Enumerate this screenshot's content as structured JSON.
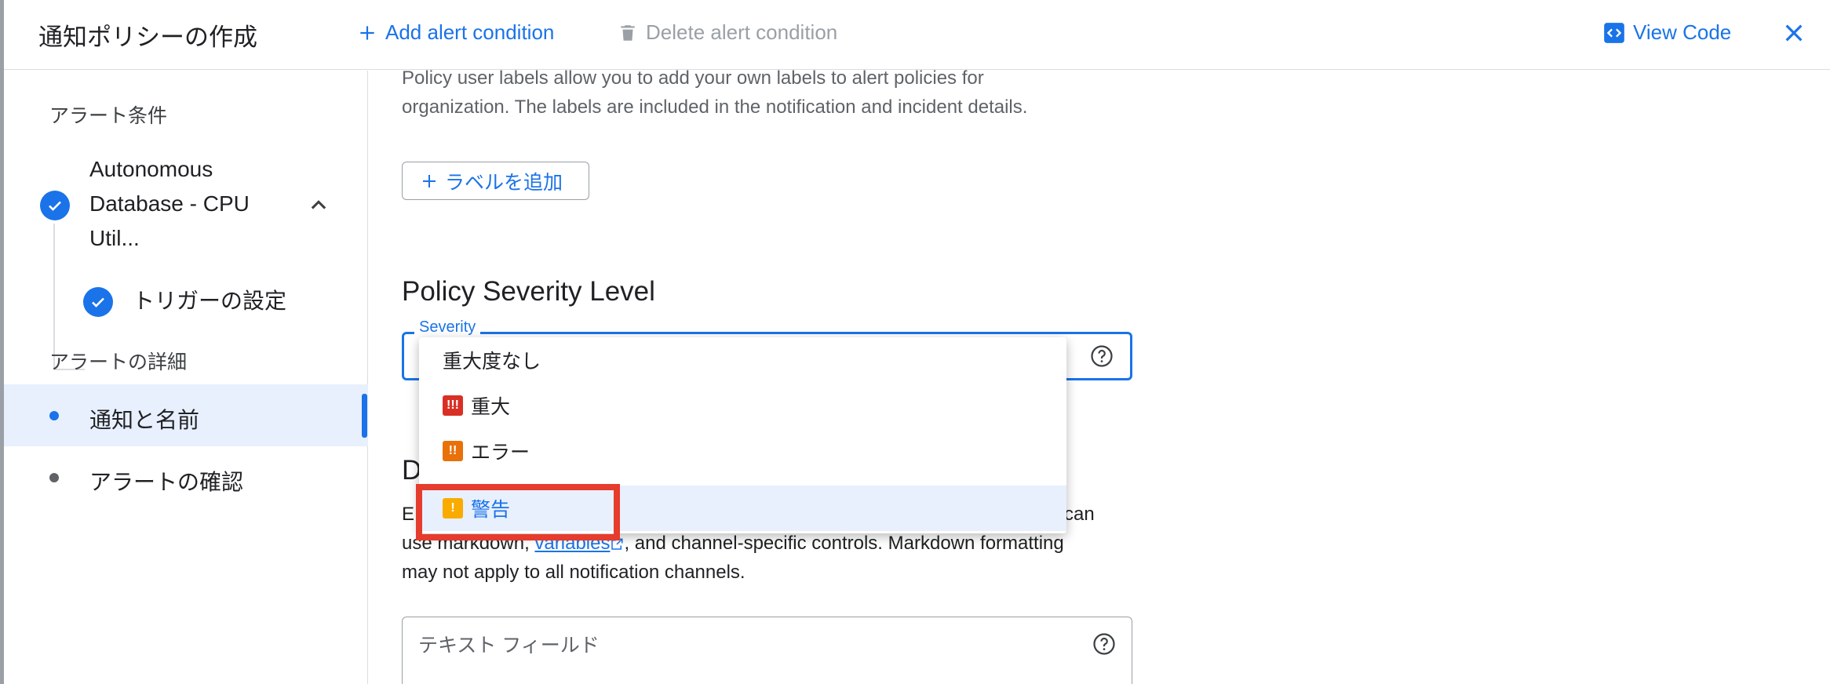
{
  "header": {
    "title": "通知ポリシーの作成",
    "add_condition": "Add alert condition",
    "delete_condition": "Delete alert condition",
    "view_code": "View Code"
  },
  "sidebar": {
    "section_conditions": "アラート条件",
    "condition_name": "Autonomous Database - CPU Util...",
    "trigger_settings": "トリガーの設定",
    "section_details": "アラートの詳細",
    "notifications_and_name": "通知と名前",
    "review_alert": "アラートの確認"
  },
  "main": {
    "labels_desc_line1": "Policy user labels allow you to add your own labels to alert policies for",
    "labels_desc_line2": "organization. The labels are included in the notification and incident details.",
    "add_label_button": "ラベルを追加",
    "severity_heading": "Policy Severity Level",
    "severity_field_label": "Severity",
    "doc_heading_partial": "D",
    "doc_line1_start": "E",
    "doc_line1_end": "can",
    "doc_line2_pre": "use markdown,",
    "doc_line2_link": "variables",
    "doc_line2_post": ", and channel-specific controls. Markdown formatting",
    "doc_line3": "may not apply to all notification channels.",
    "text_field_placeholder": "テキスト フィールド"
  },
  "severity_dropdown": {
    "options": [
      {
        "label": "重大度なし",
        "badge": "",
        "color": ""
      },
      {
        "label": "重大",
        "badge": "!!!",
        "color": "#d93025"
      },
      {
        "label": "エラー",
        "badge": "!!",
        "color": "#e8710a"
      },
      {
        "label": "警告",
        "badge": "!",
        "color": "#f9ab00"
      }
    ],
    "selected": "警告"
  },
  "colors": {
    "primary": "#1a73e8",
    "highlight_box": "#e53c2d"
  }
}
